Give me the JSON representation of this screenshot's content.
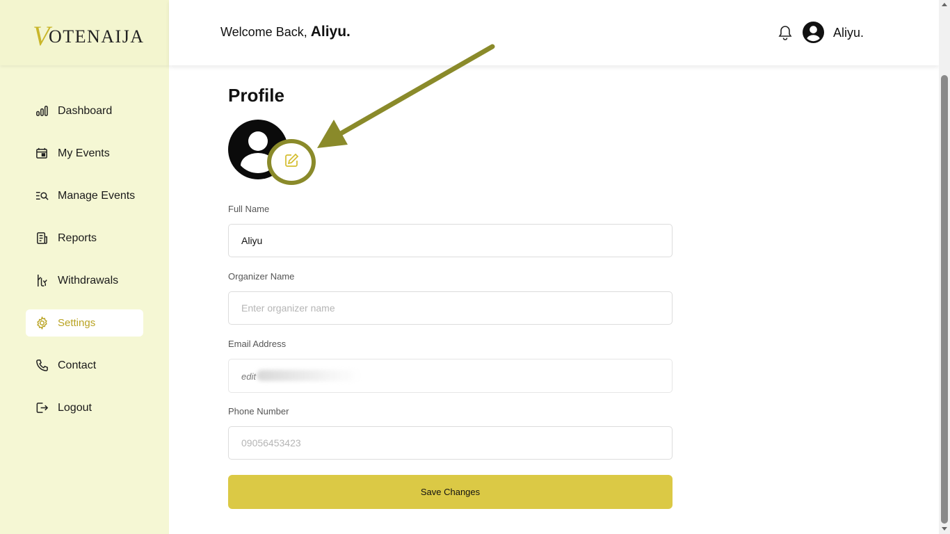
{
  "brand": {
    "logo_initial": "V",
    "logo_rest": "OTENAIJA"
  },
  "header": {
    "welcome_prefix": "Welcome Back, ",
    "welcome_name": "Aliyu.",
    "user_name": "Aliyu."
  },
  "sidebar": {
    "items": [
      {
        "label": "Dashboard",
        "icon": "bar-chart-icon"
      },
      {
        "label": "My Events",
        "icon": "calendar-icon"
      },
      {
        "label": "Manage Events",
        "icon": "list-search-icon"
      },
      {
        "label": "Reports",
        "icon": "report-icon"
      },
      {
        "label": "Withdrawals",
        "icon": "withdraw-icon"
      },
      {
        "label": "Settings",
        "icon": "gear-icon",
        "active": true
      },
      {
        "label": "Contact",
        "icon": "phone-icon"
      },
      {
        "label": "Logout",
        "icon": "logout-icon"
      }
    ]
  },
  "profile": {
    "title": "Profile",
    "full_name_label": "Full Name",
    "full_name_value": "Aliyu",
    "organizer_label": "Organizer Name",
    "organizer_placeholder": "Enter organizer name",
    "email_label": "Email Address",
    "email_value": "edit",
    "phone_label": "Phone Number",
    "phone_placeholder": "09056453423",
    "save_label": "Save Changes"
  },
  "colors": {
    "sidebar_bg": "#f5f7d4",
    "accent": "#dbc945",
    "active_text": "#b9a322",
    "annotation": "#8a8a2a"
  }
}
